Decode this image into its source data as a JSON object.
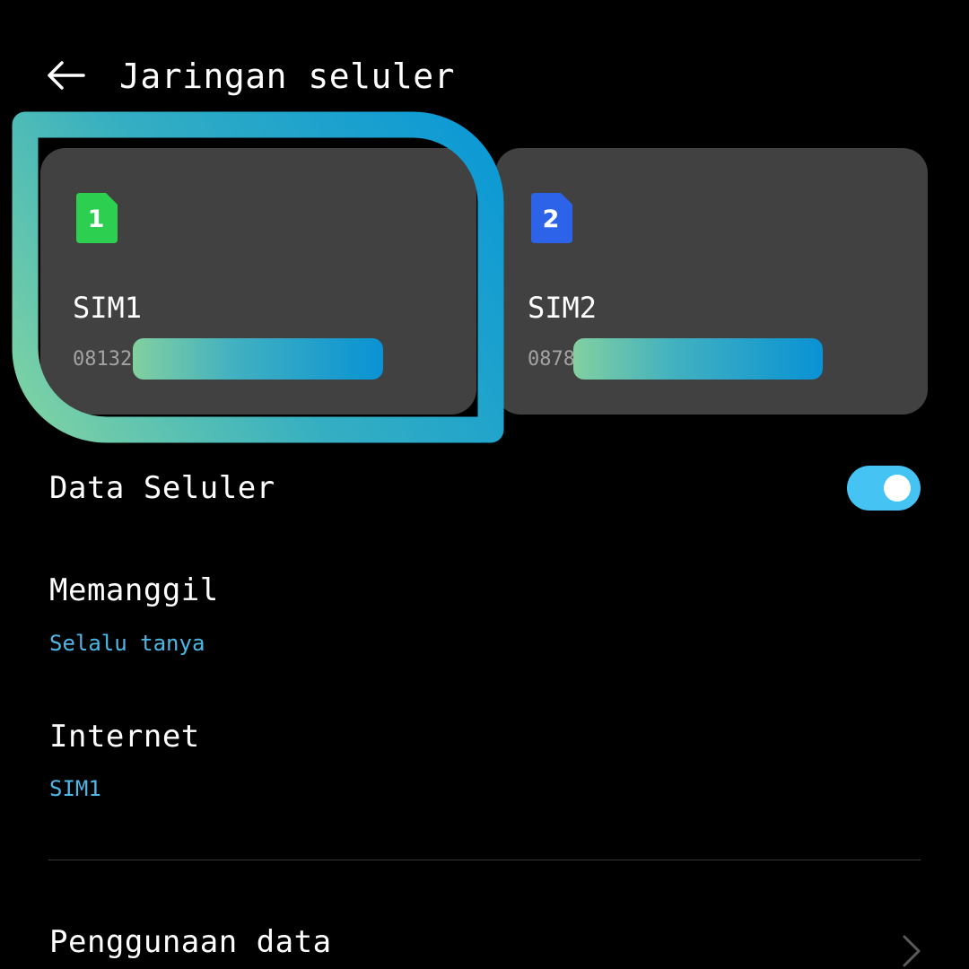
{
  "header": {
    "title": "Jaringan seluler",
    "back_icon": "arrow-left-icon"
  },
  "sims": [
    {
      "badge": "1",
      "name": "SIM1",
      "number_visible": "08132",
      "badge_color": "#2ccf4f"
    },
    {
      "badge": "2",
      "name": "SIM2",
      "number_visible": "0878",
      "badge_color": "#2d63e8"
    }
  ],
  "highlight": {
    "gradient_colors": [
      "#7fd3a3",
      "#0b98d6"
    ]
  },
  "settings": {
    "mobile_data": {
      "label": "Data Seluler",
      "enabled": true,
      "toggle_color": "#45c4f3"
    },
    "calling": {
      "label": "Memanggil",
      "value": "Selalu tanya"
    },
    "internet": {
      "label": "Internet",
      "value": "SIM1"
    },
    "data_usage": {
      "label": "Penggunaan data",
      "chevron_icon": "chevron-right-icon"
    }
  },
  "colors": {
    "background": "#000000",
    "card": "#414141",
    "accent_text": "#4cb8e6"
  }
}
